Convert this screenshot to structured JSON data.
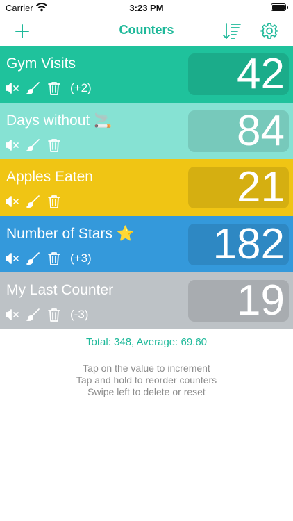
{
  "status": {
    "carrier": "Carrier",
    "time": "3:23 PM"
  },
  "nav": {
    "title": "Counters",
    "add_icon": "plus-icon",
    "sort_icon": "sort-icon",
    "settings_icon": "gear-icon"
  },
  "colors": {
    "accent": "#1fb99a"
  },
  "counters": [
    {
      "name": "Gym Visits",
      "value": "42",
      "delta": "(+2)",
      "color": "#1fc29c"
    },
    {
      "name": "Days without 🚬",
      "value": "84",
      "delta": "",
      "color": "#86e2d3"
    },
    {
      "name": "Apples Eaten",
      "value": "21",
      "delta": "",
      "color": "#f0c514"
    },
    {
      "name": "Number of Stars ⭐",
      "value": "182",
      "delta": "(+3)",
      "color": "#3499db"
    },
    {
      "name": "My Last Counter",
      "value": "19",
      "delta": "(-3)",
      "color": "#bdc2c6"
    }
  ],
  "footer": {
    "total": "Total: 348, Average: 69.60",
    "hints": [
      "Tap on the value to increment",
      "Tap and hold to reorder counters",
      "Swipe left to delete or reset"
    ]
  }
}
